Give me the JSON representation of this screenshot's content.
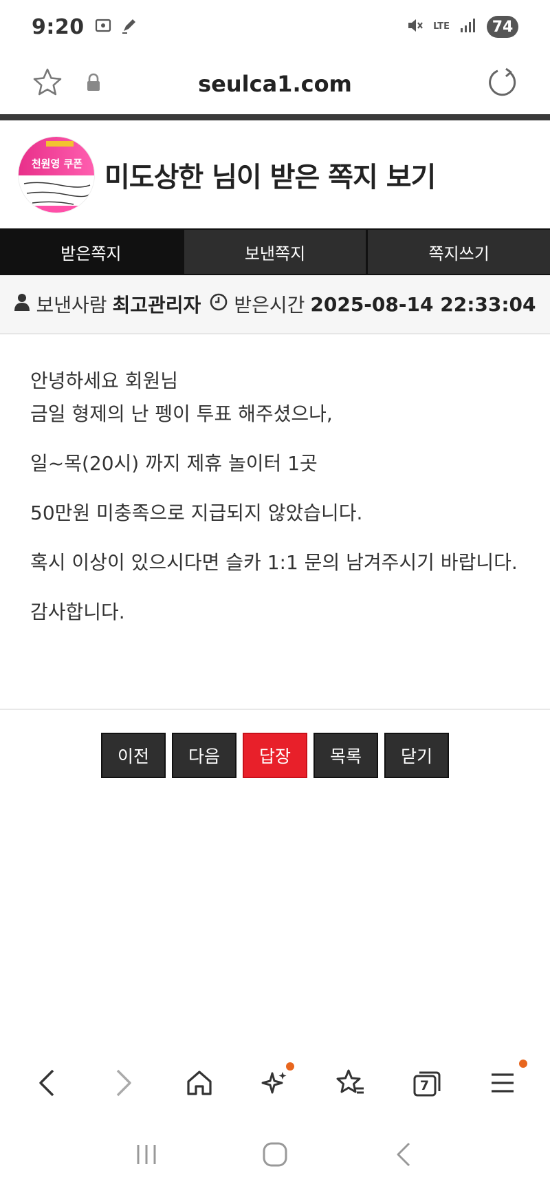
{
  "status_bar": {
    "time": "9:20",
    "network": "LTE",
    "battery": "74"
  },
  "address_bar": {
    "url": "seulca1.com"
  },
  "header": {
    "avatar_text_top": "천원영 쿠폰",
    "title": "미도상한 님이 받은 쪽지 보기"
  },
  "tabs": [
    {
      "label": "받은쪽지"
    },
    {
      "label": "보낸쪽지"
    },
    {
      "label": "쪽지쓰기"
    }
  ],
  "meta": {
    "sender_label": "보낸사람",
    "sender_name": "최고관리자",
    "received_label": "받은시간",
    "received_time": "2025-08-14 22:33:04"
  },
  "message": {
    "line1": "안녕하세요 회원님",
    "line2": "금일 형제의 난 펭이 투표 해주셨으나,",
    "line3": "일~목(20시) 까지 제휴 놀이터 1곳",
    "line4": "50만원 미충족으로 지급되지 않았습니다.",
    "line5": "혹시 이상이 있으시다면 슬카 1:1 문의 남겨주시기 바랍니다.",
    "line6": "감사합니다."
  },
  "actions": {
    "prev": "이전",
    "next": "다음",
    "reply": "답장",
    "list": "목록",
    "close": "닫기"
  },
  "browser_nav": {
    "tab_count": "7"
  },
  "colors": {
    "reply_button": "#e8202a",
    "tab_bar": "#111111",
    "notification_dot": "#e8661e"
  }
}
